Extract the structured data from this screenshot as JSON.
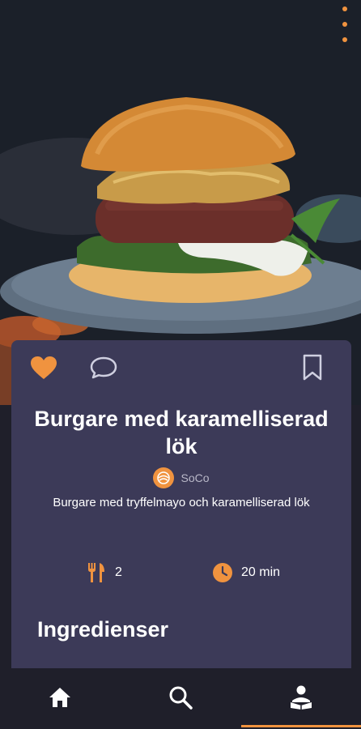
{
  "recipe": {
    "title": "Burgare med karamelliserad lök",
    "author": "SoCo",
    "description": "Burgare med tryffelmayo och karamelliserad lök",
    "servings": "2",
    "time": "20 min",
    "liked": true
  },
  "sections": {
    "ingredients_title": "Ingredienser"
  },
  "icons": {
    "like": "heart-icon",
    "comment": "comment-icon",
    "save": "bookmark-icon",
    "menu": "kebab-menu-icon",
    "servings": "cutlery-icon",
    "time": "clock-icon",
    "author_logo": "author-logo-icon"
  },
  "nav": {
    "items": [
      {
        "name": "home",
        "icon": "home-icon"
      },
      {
        "name": "search",
        "icon": "search-icon"
      },
      {
        "name": "profile",
        "icon": "reader-icon",
        "active": true
      }
    ]
  },
  "colors": {
    "accent": "#f0933f",
    "card": "#3c3a58",
    "nav_bg": "#1f1f2a"
  }
}
